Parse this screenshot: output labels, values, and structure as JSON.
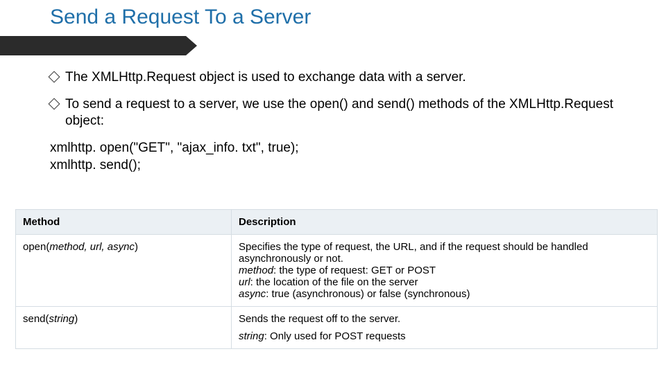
{
  "title": "Send a Request To a Server",
  "bullets": {
    "b1": "The XMLHttp.Request object is used to exchange data with a server.",
    "b2": "To send a request to a server, we use the open() and send() methods of the XMLHttp.Request object:"
  },
  "code": {
    "line1": "xmlhttp. open(\"GET\", \"ajax_info. txt\", true);",
    "line2": "xmlhttp. send();"
  },
  "table": {
    "headers": {
      "h1": "Method",
      "h2": "Description"
    },
    "row1": {
      "method_name": "open(",
      "method_args": "method, url, async",
      "method_close": ")",
      "d1": "Specifies the type of request, the URL, and if the request should be handled asynchronously or not.",
      "d2_term": "method",
      "d2_rest": ": the type of request: GET or POST",
      "d3_term": "url",
      "d3_rest": ": the location of the file on the server",
      "d4_term": "async",
      "d4_rest": ": true (asynchronous) or false (synchronous)"
    },
    "row2": {
      "method_name": "send(",
      "method_args": "string",
      "method_close": ")",
      "d1": "Sends the request off to the server.",
      "d2_term": "string",
      "d2_rest": ": Only used for POST requests"
    }
  }
}
